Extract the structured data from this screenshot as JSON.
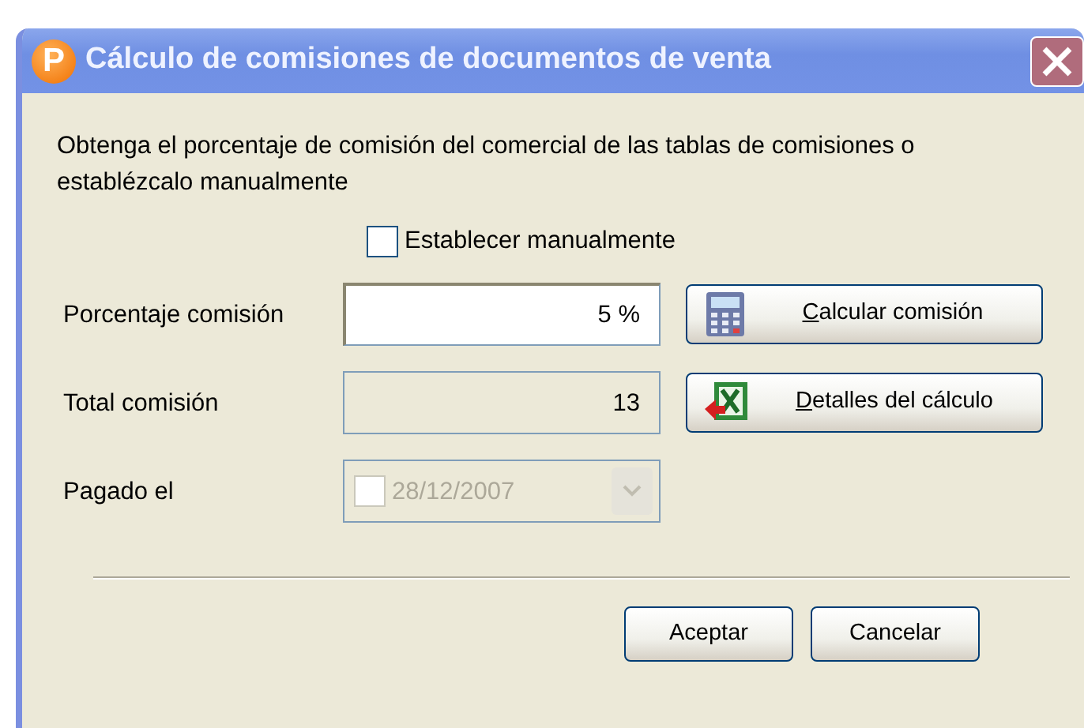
{
  "window": {
    "title": "Cálculo de comisiones de documentos de venta",
    "app_icon_letter": "P"
  },
  "description": "Obtenga el porcentaje de comisión del comercial de las tablas de comisiones o establézcalo manualmente",
  "manual_checkbox": {
    "label": "Establecer manualmente",
    "checked": false
  },
  "fields": [
    {
      "kind": "text",
      "label": "Porcentaje comisión",
      "value": "5 %",
      "disabled": false,
      "button": {
        "label": "Calcular comisión"
      }
    },
    {
      "kind": "text",
      "label": "Total comisión",
      "value": "13",
      "disabled": true,
      "button": {
        "label": "Detalles del cálculo"
      }
    },
    {
      "kind": "date",
      "label": "Pagado el",
      "value": "28/12/2007",
      "disabled": true,
      "checked": false
    }
  ],
  "buttons": [
    "Aceptar",
    "Cancelar"
  ]
}
